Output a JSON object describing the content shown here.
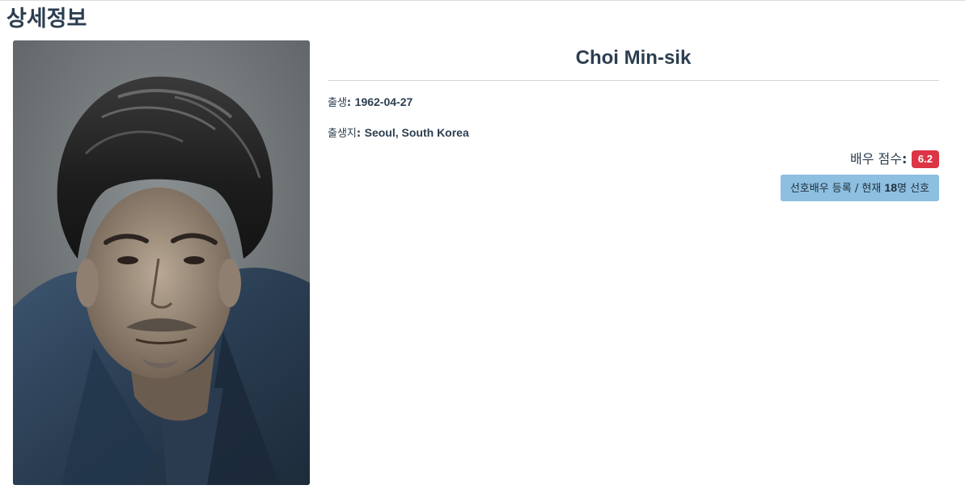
{
  "page": {
    "title": "상세정보"
  },
  "actor": {
    "name": "Choi Min-sik",
    "photo_alt": "Choi Min-sik portrait",
    "birth_label": "출생",
    "birth_value": "1962-04-27",
    "birthplace_label": "출생지",
    "birthplace_value": "Seoul, South Korea",
    "score_label": "배우 점수",
    "score_value": "6.2"
  },
  "favorite": {
    "prefix": "선호배우 등록 / 현재 ",
    "count": "18",
    "suffix": "명 선호"
  },
  "colors": {
    "score_badge": "#dc3545",
    "favorite_button": "#8dbfe0",
    "text": "#2c3e50"
  }
}
